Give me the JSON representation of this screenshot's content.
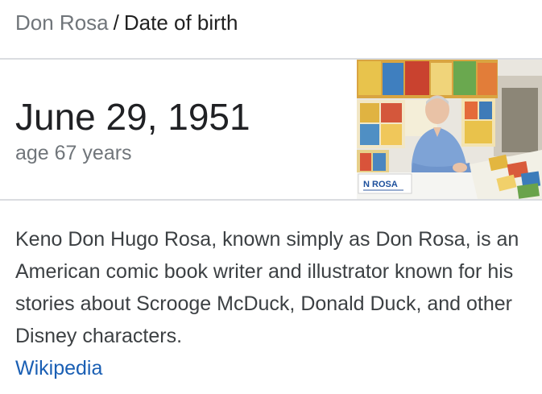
{
  "breadcrumb": {
    "entity": "Don Rosa",
    "separator": "/",
    "attribute": "Date of birth"
  },
  "answer": {
    "value": "June 29, 1951",
    "subtext": "age 67 years"
  },
  "image": {
    "sign_text": "N ROSA"
  },
  "description": {
    "text": "Keno Don Hugo Rosa, known simply as Don Rosa, is an American comic book writer and illustrator known for his stories about Scrooge McDuck, Donald Duck, and other Disney characters.",
    "source_label": "Wikipedia"
  },
  "colors": {
    "link": "#1a5fb4",
    "muted_text": "#70757a",
    "primary_text": "#202124",
    "divider": "#dadce0"
  }
}
